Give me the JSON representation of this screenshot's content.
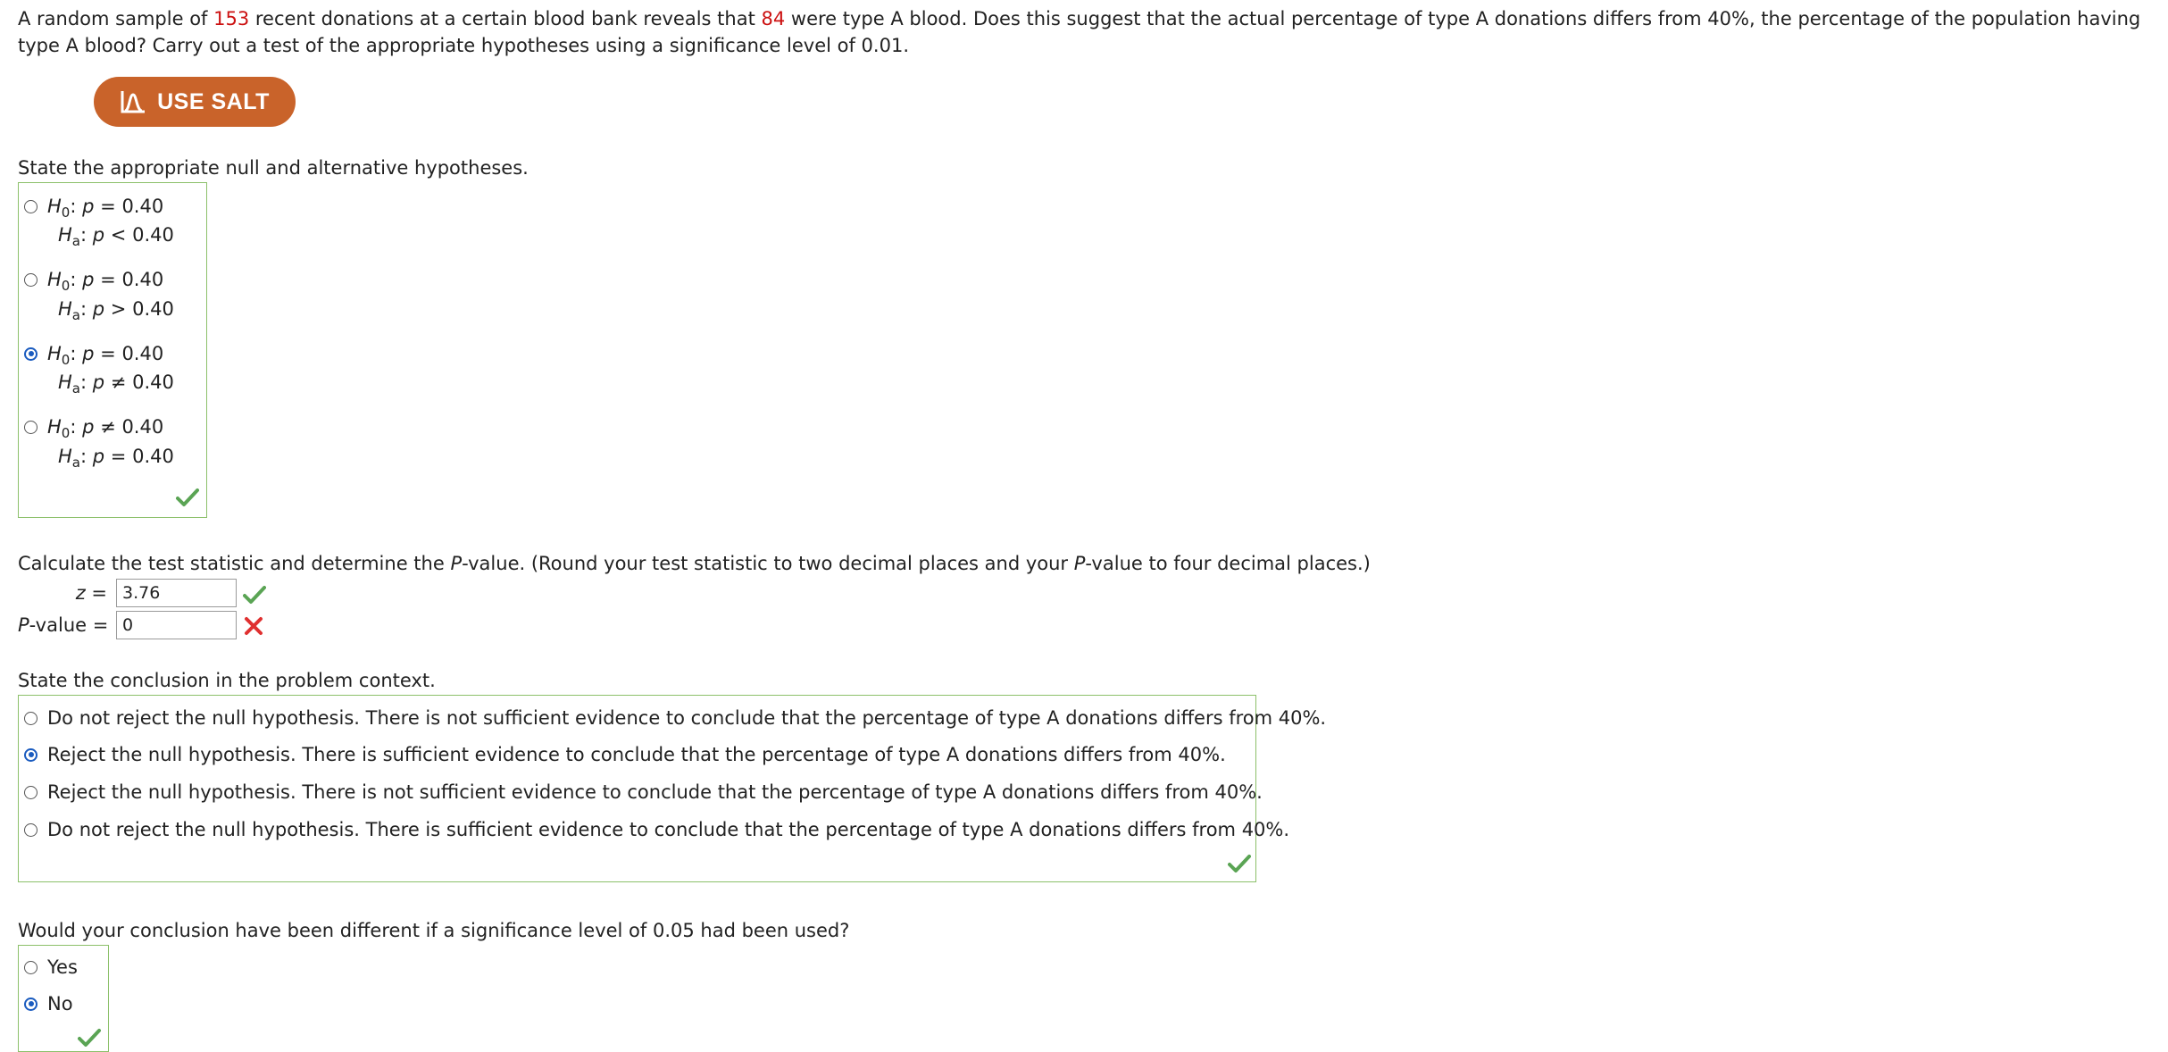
{
  "question": {
    "intro_part1": "A random sample of ",
    "sample_size": "153",
    "intro_part2": " recent donations at a certain blood bank reveals that ",
    "type_a_count": "84",
    "intro_part3": " were type A blood. Does this suggest that the actual percentage of type A donations differs from 40%, the percentage of the population having type A blood? Carry out a test of the appropriate hypotheses using a significance level of 0.01."
  },
  "salt_button": {
    "label": "USE SALT",
    "icon": "salt-chart-icon"
  },
  "hypotheses": {
    "prompt": "State the appropriate null and alternative hypotheses.",
    "options": [
      {
        "null_rel": "=",
        "null_val": "0.40",
        "alt_rel": "<",
        "alt_val": "0.40",
        "selected": false
      },
      {
        "null_rel": "=",
        "null_val": "0.40",
        "alt_rel": ">",
        "alt_val": "0.40",
        "selected": false
      },
      {
        "null_rel": "=",
        "null_val": "0.40",
        "alt_rel": "≠",
        "alt_val": "0.40",
        "selected": true
      },
      {
        "null_rel": "≠",
        "null_val": "0.40",
        "alt_rel": "=",
        "alt_val": "0.40",
        "selected": false
      }
    ],
    "status": "correct"
  },
  "statistic": {
    "prompt_part1": "Calculate the test statistic and determine the ",
    "prompt_p": "P",
    "prompt_part2": "-value. (Round your test statistic to two decimal places and your ",
    "prompt_part3": "-value to four decimal places.)",
    "z_label": "z",
    "z_value": "3.76",
    "z_status": "correct",
    "p_label_suffix": "-value",
    "p_value": "0",
    "p_status": "incorrect"
  },
  "conclusion": {
    "prompt": "State the conclusion in the problem context.",
    "options": [
      {
        "label": "Do not reject the null hypothesis. There is not sufficient evidence to conclude that the percentage of type A donations differs from 40%.",
        "selected": false
      },
      {
        "label": "Reject the null hypothesis. There is sufficient evidence to conclude that the percentage of type A donations differs from 40%.",
        "selected": true
      },
      {
        "label": "Reject the null hypothesis. There is not sufficient evidence to conclude that the percentage of type A donations differs from 40%.",
        "selected": false
      },
      {
        "label": "Do not reject the null hypothesis. There is sufficient evidence to conclude that the percentage of type A donations differs from 40%.",
        "selected": false
      }
    ],
    "status": "correct"
  },
  "significance": {
    "prompt": "Would your conclusion have been different if a significance level of 0.05 had been used?",
    "options": [
      {
        "label": "Yes",
        "selected": false
      },
      {
        "label": "No",
        "selected": true
      }
    ],
    "status": "correct"
  },
  "colors": {
    "accent": "#c9632a",
    "highlight": "#cc1111",
    "correct": "#5aa454",
    "incorrect": "#e03030",
    "box_border": "#8cc06a",
    "radio_selected": "#1a5bbf"
  }
}
